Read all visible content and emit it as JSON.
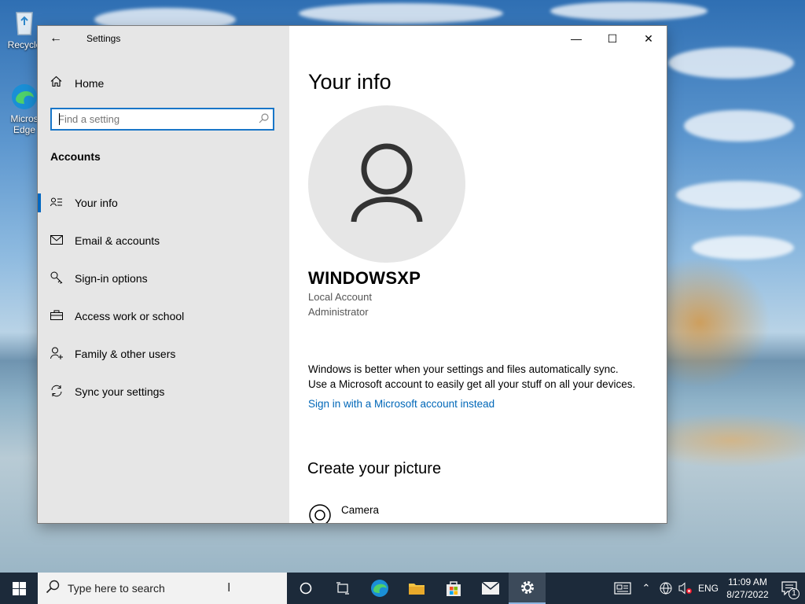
{
  "desktop": {
    "icons": [
      {
        "name": "recycle-bin",
        "label": "Recycle"
      },
      {
        "name": "microsoft-edge",
        "label": "Micros Edge"
      }
    ]
  },
  "window": {
    "title": "Settings",
    "back_icon": "arrow-left-icon",
    "controls": {
      "minimize": "—",
      "maximize": "☐",
      "close": "✕"
    }
  },
  "sidebar": {
    "home_label": "Home",
    "search_placeholder": "Find a setting",
    "section": "Accounts",
    "items": [
      {
        "label": "Your info",
        "icon": "person-card-icon",
        "active": true
      },
      {
        "label": "Email & accounts",
        "icon": "mail-icon",
        "active": false
      },
      {
        "label": "Sign-in options",
        "icon": "key-icon",
        "active": false
      },
      {
        "label": "Access work or school",
        "icon": "briefcase-icon",
        "active": false
      },
      {
        "label": "Family & other users",
        "icon": "person-add-icon",
        "active": false
      },
      {
        "label": "Sync your settings",
        "icon": "sync-icon",
        "active": false
      }
    ]
  },
  "main": {
    "title": "Your info",
    "user": {
      "name": "WINDOWSXP",
      "account_type": "Local Account",
      "role": "Administrator"
    },
    "sync_text_1": "Windows is better when your settings and files automatically sync.",
    "sync_text_2": "Use a Microsoft account to easily get all your stuff on all your devices.",
    "signin_link": "Sign in with a Microsoft account instead",
    "create_picture_heading": "Create your picture",
    "camera_label": "Camera"
  },
  "taskbar": {
    "search_placeholder": "Type here to search",
    "tray": {
      "language": "ENG",
      "time": "11:09 AM",
      "date": "8/27/2022",
      "notification_count": "1"
    }
  },
  "colors": {
    "accent": "#0067c0",
    "link": "#0067b8",
    "sidebar_bg": "#e6e6e6",
    "taskbar_bg": "#1c2a3a"
  }
}
